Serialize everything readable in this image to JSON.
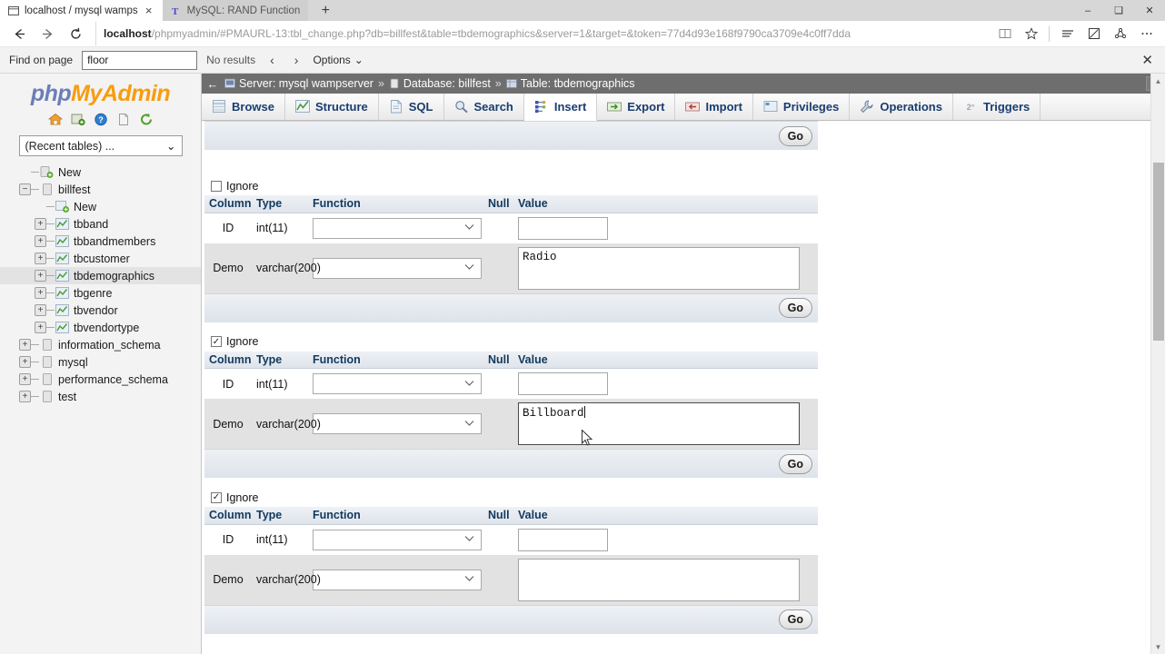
{
  "browser": {
    "tabs": [
      {
        "title": "localhost / mysql wamps",
        "icon": "page-icon",
        "active": true,
        "close": "×"
      },
      {
        "title": "MySQL: RAND Function",
        "icon": "t-icon",
        "active": false,
        "close": ""
      }
    ],
    "new_tab_label": "+",
    "window_controls": {
      "minimize": "–",
      "maximize": "❑",
      "close": "✕"
    },
    "nav": {
      "back": "←",
      "forward": "→",
      "reload": "↻"
    },
    "url": {
      "host": "localhost",
      "path": "/phpmyadmin/#PMAURL-13:tbl_change.php?db=billfest&table=tbdemographics&server=1&target=&token=77d4d93e168f9790ca3709e4c0ff7dda"
    },
    "toolbar_icons": [
      "reading-view-icon",
      "favorites-star-icon",
      "hub-icon",
      "web-note-icon",
      "share-icon",
      "more-icon"
    ]
  },
  "findbar": {
    "label": "Find on page",
    "value": "floor",
    "placeholder": "",
    "results": "No results",
    "prev": "‹",
    "next": "›",
    "options": "Options",
    "options_chevron": "⌄",
    "close": "✕"
  },
  "sidebar": {
    "logo": {
      "php": "php",
      "my": "My",
      "admin": "Admin"
    },
    "quick_icons": [
      "home-icon",
      "new-window-icon",
      "help-icon",
      "docs-icon",
      "refresh-icon"
    ],
    "recent_select": {
      "value": "(Recent tables) ...",
      "chevron": "⌄"
    },
    "tree": [
      {
        "label": "New",
        "level": 0,
        "toggle": "",
        "icon": "new-db-icon",
        "selected": false
      },
      {
        "label": "billfest",
        "level": 0,
        "toggle": "−",
        "icon": "db-icon",
        "selected": false
      },
      {
        "label": "New",
        "level": 1,
        "toggle": "",
        "icon": "new-table-icon",
        "selected": false
      },
      {
        "label": "tbband",
        "level": 1,
        "toggle": "+",
        "icon": "table-icon",
        "selected": false
      },
      {
        "label": "tbbandmembers",
        "level": 1,
        "toggle": "+",
        "icon": "table-icon",
        "selected": false
      },
      {
        "label": "tbcustomer",
        "level": 1,
        "toggle": "+",
        "icon": "table-icon",
        "selected": false
      },
      {
        "label": "tbdemographics",
        "level": 1,
        "toggle": "+",
        "icon": "table-icon",
        "selected": true
      },
      {
        "label": "tbgenre",
        "level": 1,
        "toggle": "+",
        "icon": "table-icon",
        "selected": false
      },
      {
        "label": "tbvendor",
        "level": 1,
        "toggle": "+",
        "icon": "table-icon",
        "selected": false
      },
      {
        "label": "tbvendortype",
        "level": 1,
        "toggle": "+",
        "icon": "table-icon",
        "selected": false
      },
      {
        "label": "information_schema",
        "level": 0,
        "toggle": "+",
        "icon": "db-icon",
        "selected": false
      },
      {
        "label": "mysql",
        "level": 0,
        "toggle": "+",
        "icon": "db-icon",
        "selected": false
      },
      {
        "label": "performance_schema",
        "level": 0,
        "toggle": "+",
        "icon": "db-icon",
        "selected": false
      },
      {
        "label": "test",
        "level": 0,
        "toggle": "+",
        "icon": "db-icon",
        "selected": false
      }
    ]
  },
  "breadcrumb": {
    "back": "←",
    "server": "Server: mysql wampserver",
    "database": "Database: billfest",
    "table": "Table: tbdemographics",
    "sep": "»",
    "collapse": "⌃"
  },
  "main_tabs": [
    {
      "label": "Browse",
      "icon": "browse-icon",
      "active": false
    },
    {
      "label": "Structure",
      "icon": "structure-icon",
      "active": false
    },
    {
      "label": "SQL",
      "icon": "sql-icon",
      "active": false
    },
    {
      "label": "Search",
      "icon": "search-icon",
      "active": false
    },
    {
      "label": "Insert",
      "icon": "insert-icon",
      "active": true
    },
    {
      "label": "Export",
      "icon": "export-icon",
      "active": false
    },
    {
      "label": "Import",
      "icon": "import-icon",
      "active": false
    },
    {
      "label": "Privileges",
      "icon": "privileges-icon",
      "active": false
    },
    {
      "label": "Operations",
      "icon": "operations-icon",
      "active": false
    },
    {
      "label": "Triggers",
      "icon": "triggers-icon",
      "active": false
    }
  ],
  "insert_form": {
    "go_label": "Go",
    "ignore_label": "Ignore",
    "headers": {
      "column": "Column",
      "type": "Type",
      "function": "Function",
      "null": "Null",
      "value": "Value"
    },
    "blocks": [
      {
        "ignore_checked": false,
        "rows": [
          {
            "column": "ID",
            "type": "int(11)",
            "function": "",
            "value": "",
            "input_kind": "text",
            "focused": false
          },
          {
            "column": "Demo",
            "type": "varchar(200)",
            "function": "",
            "value": "Radio",
            "input_kind": "textarea",
            "focused": false
          }
        ]
      },
      {
        "ignore_checked": true,
        "rows": [
          {
            "column": "ID",
            "type": "int(11)",
            "function": "",
            "value": "",
            "input_kind": "text",
            "focused": false
          },
          {
            "column": "Demo",
            "type": "varchar(200)",
            "function": "",
            "value": "Billboard",
            "input_kind": "textarea",
            "focused": true
          }
        ]
      },
      {
        "ignore_checked": true,
        "rows": [
          {
            "column": "ID",
            "type": "int(11)",
            "function": "",
            "value": "",
            "input_kind": "text",
            "focused": false
          },
          {
            "column": "Demo",
            "type": "varchar(200)",
            "function": "",
            "value": "",
            "input_kind": "textarea",
            "focused": false
          }
        ]
      }
    ]
  },
  "scrollbar": {
    "up": "▲",
    "down": "▼"
  },
  "colors": {
    "breadcrumb_bg": "#6e6e6e",
    "tab_text": "#1a3c6e",
    "header_bg": "#e4e9ef",
    "row_alt": "#e2e2e2",
    "logo_orange": "#f89c0e",
    "logo_blue": "#6c7eb7"
  }
}
